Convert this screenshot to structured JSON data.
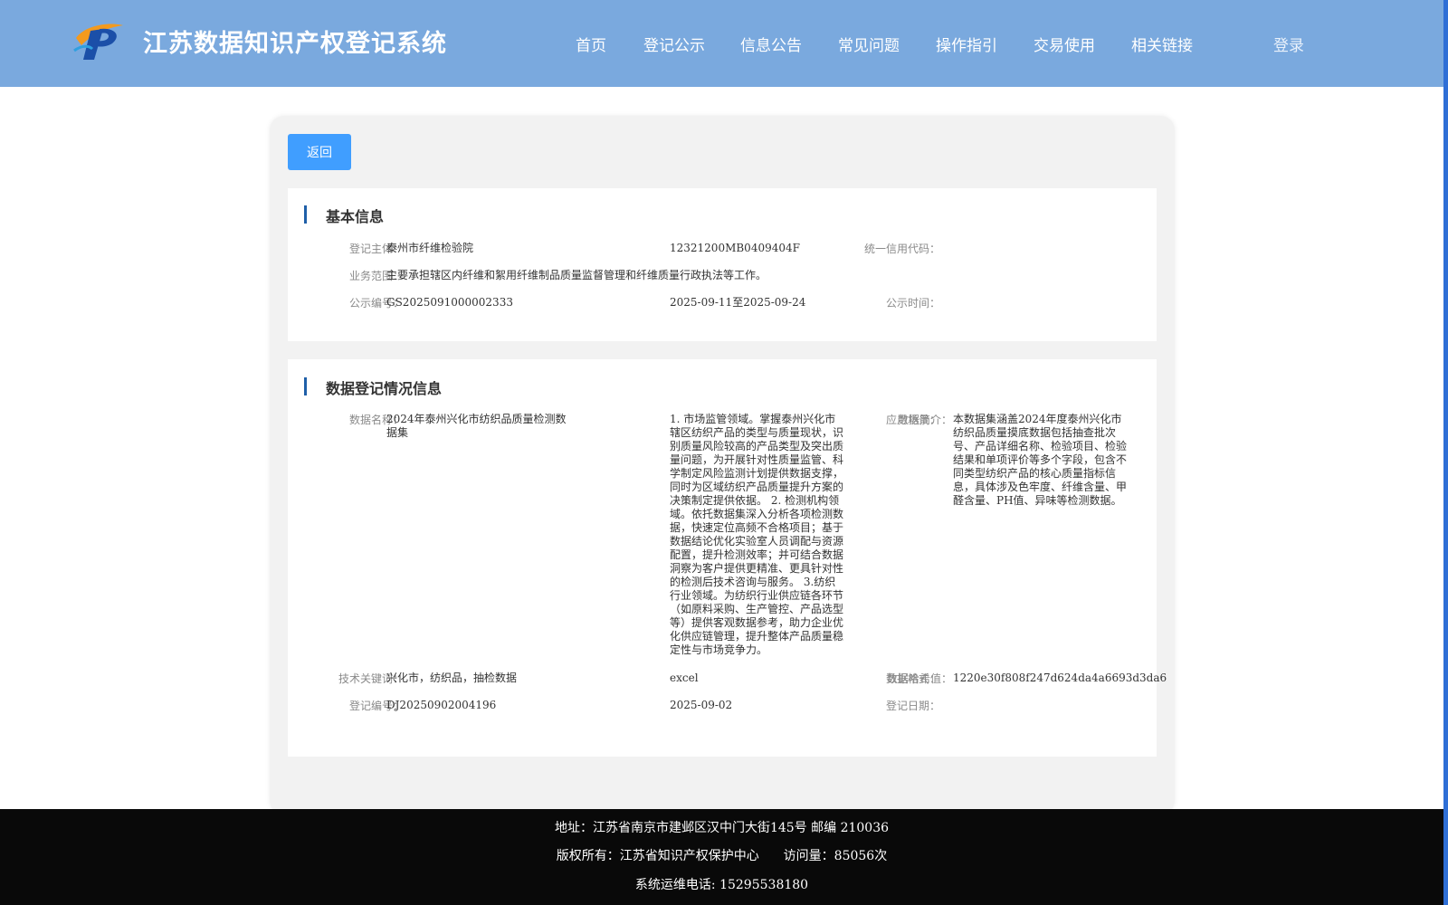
{
  "header": {
    "title": "江苏数据知识产权登记系统",
    "logo_icon": "ip-logo-icon",
    "nav": [
      "首页",
      "登记公示",
      "信息公告",
      "常见问题",
      "操作指引",
      "交易使用",
      "相关链接"
    ],
    "login_label": "登录"
  },
  "back_label": "返回",
  "basic_info": {
    "title": "基本信息",
    "subject_label": "登记主体：",
    "subject_value": "泰州市纤维检验院",
    "credit_label": "统一信用代码：",
    "credit_value": "12321200MB0409404F",
    "scope_label": "业务范围：",
    "scope_value": "主要承担辖区内纤维和絮用纤维制品质量监督管理和纤维质量行政执法等工作。",
    "pub_no_label": "公示编号：",
    "pub_no_value": "GS2025091000002333",
    "pub_time_label": "公示时间：",
    "pub_time_value": "2025-09-11至2025-09-24"
  },
  "registration_info": {
    "title": "数据登记情况信息",
    "data_name_label": "数据名称：",
    "data_name_value": "2024年泰州兴化市纺织品质量检测数据集",
    "scenario_label": "应用场景：",
    "scenario_value": "1. 市场监管领域。掌握泰州兴化市辖区纺织产品的类型与质量现状，识别质量风险较高的产品类型及突出质量问题，为开展针对性质量监管、科学制定风险监测计划提供数据支撑，同时为区域纺织产品质量提升方案的决策制定提供依据。 2. 检测机构领域。依托数据集深入分析各项检测数据，快速定位高频不合格项目；基于数据结论优化实验室人员调配与资源配置，提升检测效率；并可结合数据洞察为客户提供更精准、更具针对性的检测后技术咨询与服务。 3.纺织行业领域。为纺织行业供应链各环节（如原料采购、生产管控、产品选型等）提供客观数据参考，助力企业优化供应链管理，提升整体产品质量稳定性与市场竞争力。",
    "summary_label": "数据简介：",
    "summary_value": "本数据集涵盖2024年度泰州兴化市纺织品质量摸底数据包括抽查批次号、产品详细名称、检验项目、检验结果和单项评价等多个字段，包含不同类型纺织产品的核心质量指标信息，具体涉及色牢度、纤维含量、甲醛含量、PH值、异味等检测数据。",
    "keywords_label": "技术关键词：",
    "keywords_value": "兴化市，纺织品，抽检数据",
    "format_label": "数据格式：",
    "format_value": "excel",
    "hash_label": "数据哈希值：",
    "hash_value": "1220e30f808f247d624da4a6693d3da6",
    "reg_no_label": "登记编号：",
    "reg_no_value": "DJ20250902004196",
    "reg_date_label": "登记日期：",
    "reg_date_value": "2025-09-02"
  },
  "footer": {
    "address": "地址：江苏省南京市建邺区汉中门大街145号 邮编 210036",
    "copyright": "版权所有：江苏省知识产权保护中心",
    "visits": "访问量：85056次",
    "phone": "系统运维电话: 15295538180"
  },
  "colors": {
    "header_bg": "#7aa9de",
    "accent": "#409eff",
    "section_bar": "#1f5fa8",
    "footer_bg": "#090909"
  }
}
